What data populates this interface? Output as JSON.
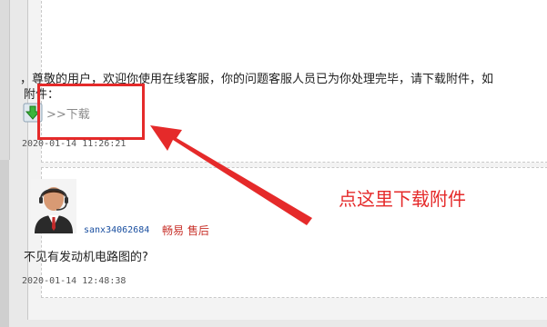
{
  "message": {
    "notice_text": "，尊敬的用户，欢迎你使用在线客服，你的问题客服人员已为你处理完毕，请下载附件，如",
    "attachment_label": "附件：",
    "download_text": ">>下载",
    "timestamp": "2020-01-14 11:26:21"
  },
  "reply": {
    "username": "sanx34062684",
    "department": "畅易 售后",
    "question": "不见有发动机电路图的?",
    "timestamp": "2020-01-14 12:48:38"
  },
  "annotation": {
    "callout_text": "点这里下载附件",
    "color": "#e52a2a"
  },
  "icons": {
    "download": "download-arrow-icon",
    "avatar": "customer-service-avatar"
  }
}
